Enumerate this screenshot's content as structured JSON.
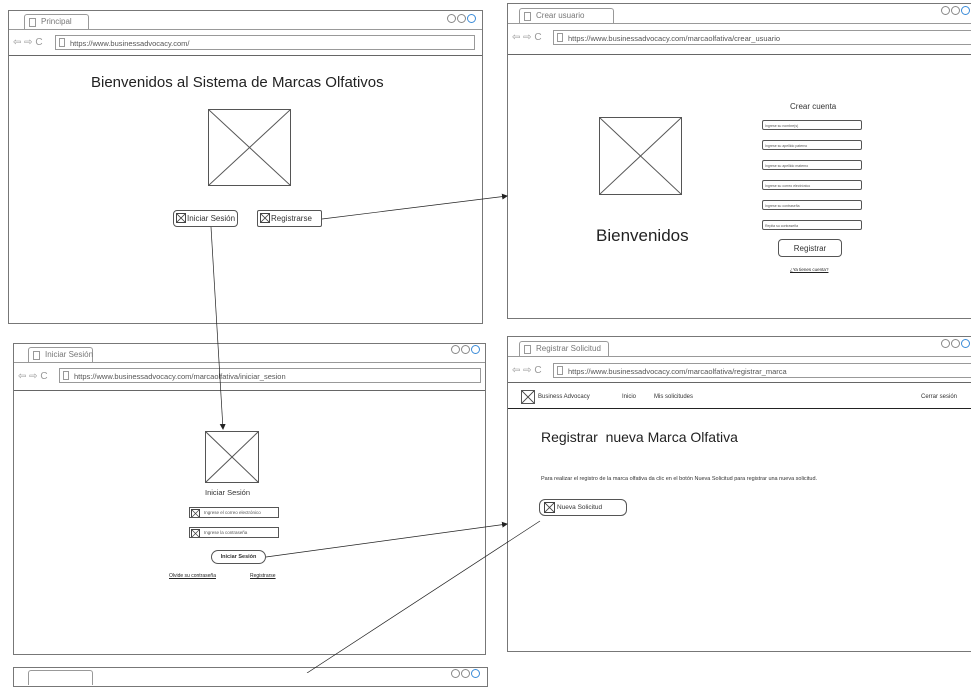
{
  "nav_glyphs": "⇦ ⇨ C",
  "icons": {
    "page": "page-icon",
    "placeholder": "image-placeholder-icon",
    "window_controls": "window-circles-icon"
  },
  "principal": {
    "tab": "Principal",
    "url": "https://www.businessadvocacy.com/",
    "heading": "Bienvenidos al Sistema de Marcas Olfativos",
    "login_button": "Iniciar Sesión",
    "register_button": "Registrarse"
  },
  "crear_usuario": {
    "tab": "Crear usuario",
    "url": "https://www.businessadvocacy.com/marcaolfativa/crear_usuario",
    "welcome": "Bienvenidos",
    "form_title": "Crear cuenta",
    "fields": [
      "Ingrese su nombre(s)",
      "Ingrese su apellido paterno",
      "Ingrese su apellido materno",
      "Ingrese su correo electrónico",
      "Ingrese su contraseña",
      "Repita su contraseña"
    ],
    "submit": "Registrar",
    "have_account": "¿Ya tienes cuenta?"
  },
  "iniciar_sesion": {
    "tab": "Iniciar Sesión",
    "url": "https://www.businessadvocacy.com/marcaolfativa/iniciar_sesion",
    "title": "Iniciar Sesión",
    "email_placeholder": "Ingrese el correo electrónico",
    "password_placeholder": "Ingrese la contraseña",
    "submit": "Iniciar Sesión",
    "forgot": "Olvide su contraseña",
    "register": "Registrarse"
  },
  "registrar_solicitud": {
    "tab": "Registrar Solicitud",
    "url": "https://www.businessadvocacy.com/marcaolfativa/registrar_marca",
    "brand": "Business Advocacy",
    "menu": [
      "Inicio",
      "Mis solicitudes"
    ],
    "logout": "Cerrar sesión",
    "heading": "Registrar  nueva Marca Olfativa",
    "description": "Para realizar el registro de la marca olfativa da clic en el botón Nueva Solicitud para registrar una nueva solicitud.",
    "new_request": "Nueva Solicitud"
  },
  "colors": {
    "window_border": "#777777",
    "accent_circle": "#3a8bd8",
    "line": "#222222"
  }
}
